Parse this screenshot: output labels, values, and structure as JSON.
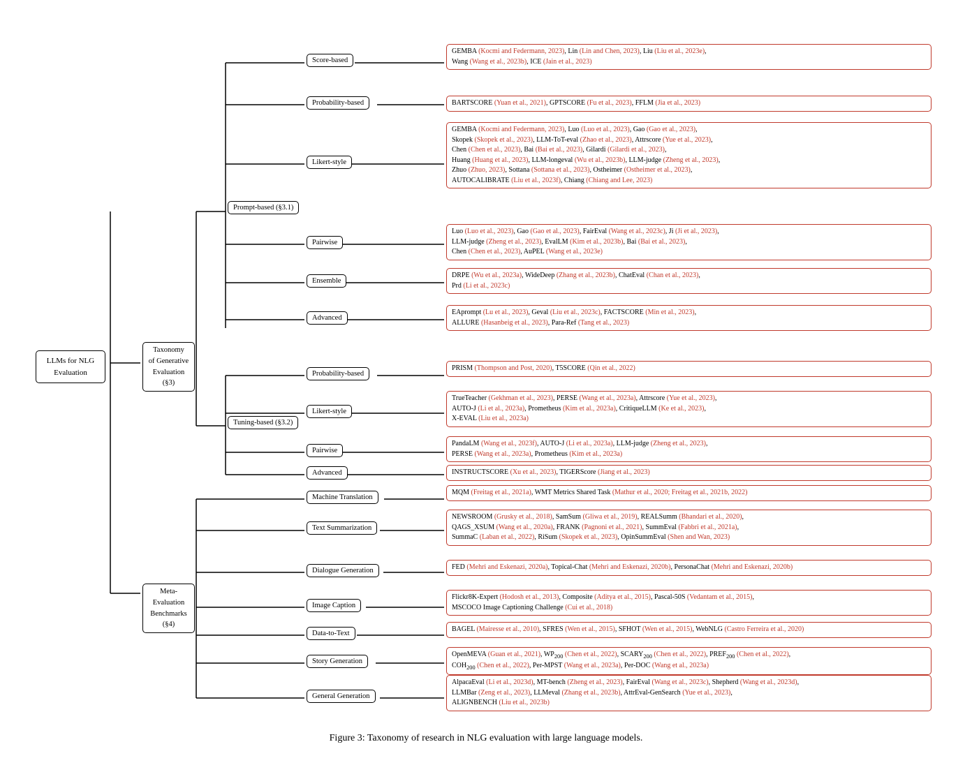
{
  "title": "LLMs for NLG Evaluation",
  "root": "LLMs for NLG\nEvaluation",
  "figure_caption": "Figure 3: Taxonomy of research in NLG evaluation with large language models.",
  "taxonomy_label": "Taxonomy\nof Generative\nEvaluation (§3)",
  "meta_eval_label": "Meta-Evaluation\nBenchmarks (§4)",
  "prompt_based_label": "Prompt-based (§3.1)",
  "tuning_based_label": "Tuning-based (§3.2)",
  "nodes": {
    "score_based": "Score-based",
    "probability_based_1": "Probability-based",
    "likert_style_1": "Likert-style",
    "pairwise_1": "Pairwise",
    "ensemble": "Ensemble",
    "advanced_1": "Advanced",
    "probability_based_2": "Probability-based",
    "likert_style_2": "Likert-style",
    "pairwise_2": "Pairwise",
    "advanced_2": "Advanced",
    "machine_translation": "Machine Translation",
    "text_summarization": "Text Summarization",
    "dialogue_generation": "Dialogue Generation",
    "image_caption": "Image Caption",
    "data_to_text": "Data-to-Text",
    "story_generation": "Story Generation",
    "general_generation": "General Generation"
  },
  "content": {
    "score_based": "GEMBA (Kocmi and Federmann, 2023), Lin (Lin and Chen, 2023), Liu (Liu et al., 2023e),\nWang (Wang et al., 2023b), ICE (Jain et al., 2023)",
    "probability_based_1": "BARTSCORE (Yuan et al., 2021), GPTSCORE (Fu et al., 2023), FFLM (Jia et al., 2023)",
    "likert_style_1": "GEMBA (Kocmi and Federmann, 2023), Luo (Luo et al., 2023), Gao (Gao et al., 2023),\nSkopek (Skopek et al., 2023), LLM-ToT-eval (Zhao et al., 2023), Attrscore (Yue et al., 2023),\nChen (Chen et al., 2023), Bai (Bai et al., 2023), Gilardi (Gilardi et al., 2023),\nHuang (Huang et al., 2023), LLM-longeval (Wu et al., 2023b), LLM-judge (Zheng et al., 2023),\nZhuo (Zhuo, 2023), Sottana (Sottana et al., 2023), Ostheimer (Ostheimer et al., 2023),\nAUTOCALIBRATE (Liu et al., 2023f), Chiang (Chiang and Lee, 2023)",
    "pairwise_1": "Luo (Luo et al., 2023), Gao (Gao et al., 2023), FairEval (Wang et al., 2023c), Ji (Ji et al., 2023),\nLLM-judge (Zheng et al., 2023), EvalLM (Kim et al., 2023b), Bai (Bai et al., 2023),\nChen (Chen et al., 2023), AuPEL (Wang et al., 2023e)",
    "ensemble": "DRPE (Wu et al., 2023a), WideDeep (Zhang et al., 2023b), ChatEval (Chan et al., 2023),\nPrd (Li et al., 2023c)",
    "advanced_1": "EAprompt (Lu et al., 2023), Geval (Liu et al., 2023c), FACTSCORE (Min et al., 2023),\nALLURE (Hasanbeig et al., 2023), Para-Ref (Tang et al., 2023)",
    "probability_based_2": "PRISM (Thompson and Post, 2020), T5SCORE (Qin et al., 2022)",
    "likert_style_2": "TrueTeacher (Gekhman et al., 2023), PERSE (Wang et al., 2023a), Attrscore (Yue et al., 2023),\nAUTO-J (Li et al., 2023a), Prometheus (Kim et al., 2023a), CritiqueLLM (Ke et al., 2023) ,\nX-EVAL (Liu et al., 2023a)",
    "pairwise_2": "PandaLM (Wang et al., 2023f), AUTO-J (Li et al., 2023a), LLM-judge (Zheng et al., 2023),\nPERSE (Wang et al., 2023a), Prometheus (Kim et al., 2023a)",
    "advanced_2": "INSTRUCTSCORE (Xu et al., 2023), TIGERScore (Jiang et al., 2023)",
    "machine_translation": "MQM (Freitag et al., 2021a), WMT Metrics Shared Task (Mathur et al., 2020; Freitag et al., 2021b, 2022)",
    "text_summarization": "NEWSROOM (Grusky et al., 2018), SamSum (Gliwa et al., 2019), REALSumm (Bhandari et al., 2020),\nQAGS_XSUM (Wang et al., 2020a), FRANK (Pagnoni et al., 2021), SummEval (Fabbri et al., 2021a),\nSummaC (Laban et al., 2022), RiSum (Skopek et al., 2023), OpinSummEval (Shen and Wan, 2023)",
    "dialogue_generation": "FED (Mehri and Eskenazi, 2020a), Topical-Chat (Mehri and Eskenazi, 2020b), PersonaChat (Mehri and Eskenazi, 2020b)",
    "image_caption": "Flickr8K-Expert (Hodosh et al., 2013), Composite (Aditya et al., 2015), Pascal-50S (Vedantam et al., 2015),\nMSCOCO Image Captioning Challenge (Cui et al., 2018)",
    "data_to_text": "BAGEL (Mairesse et al., 2010), SFRES (Wen et al., 2015), SFHOT (Wen et al., 2015), WebNLG (Castro Ferreira et al., 2020)",
    "story_generation": "OpenMEVA (Guan et al., 2021), WP₂₀₀ (Chen et al., 2022), SCARY₂₀₀ (Chen et al., 2022), PREF₂₀₀ (Chen et al., 2022),\nCOH₂₀₀ (Chen et al., 2022), Per-MPST (Wang et al., 2023a), Per-DOC (Wang et al., 2023a)",
    "general_generation": "AlpacaEval (Li et al., 2023d), MT-bench (Zheng et al., 2023), FairEval (Wang et al., 2023c), Shepherd (Wang et al., 2023d),\nLLMBar (Zeng et al., 2023), LLMeval (Zhang et al., 2023b), AttrEval-GenSearch (Yue et al., 2023),\nALIGNBENCH (Liu et al., 2023b)"
  }
}
